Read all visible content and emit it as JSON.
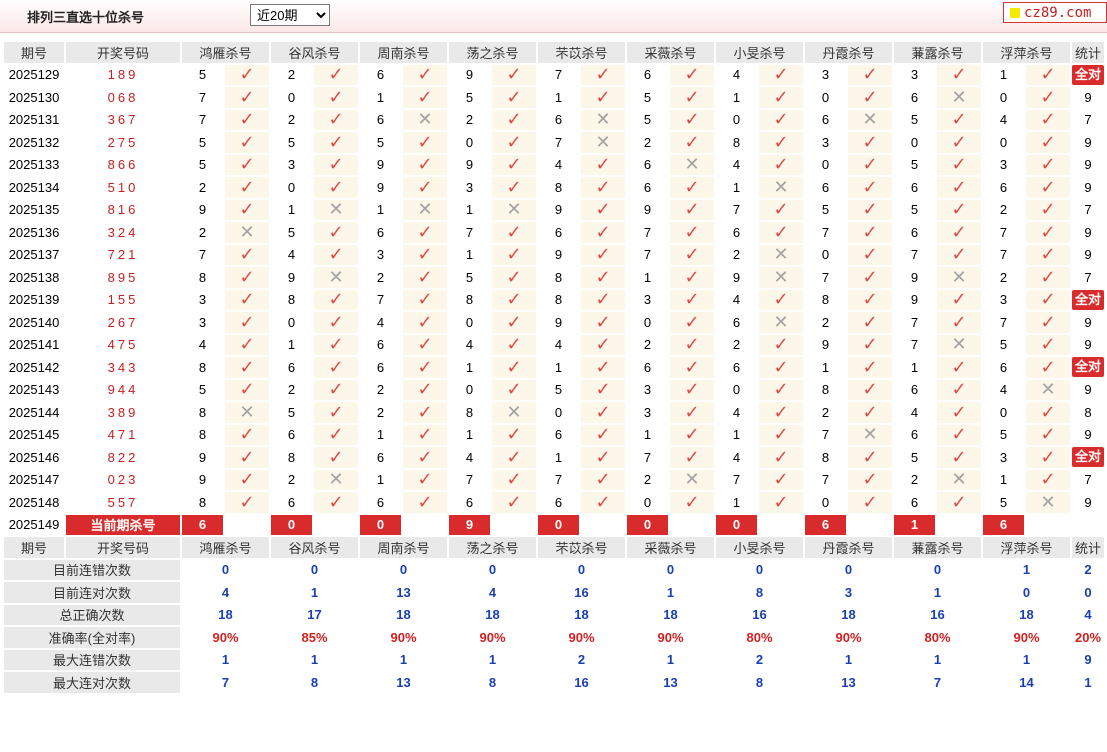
{
  "header": {
    "title": "排列三直选十位杀号",
    "select_value": "近20期",
    "select_options": [
      "近20期"
    ],
    "logo_text": "cz89.com"
  },
  "columns": {
    "period": "期号",
    "draw": "开奖号码",
    "experts": [
      "鸿雁杀号",
      "谷风杀号",
      "周南杀号",
      "荡之杀号",
      "芣苡杀号",
      "采薇杀号",
      "小旻杀号",
      "丹霞杀号",
      "蒹露杀号",
      "浮萍杀号"
    ],
    "stats": "统计"
  },
  "rows": [
    {
      "period": "2025129",
      "draw": "189",
      "kills": [
        [
          5,
          1
        ],
        [
          2,
          1
        ],
        [
          6,
          1
        ],
        [
          9,
          1
        ],
        [
          7,
          1
        ],
        [
          6,
          1
        ],
        [
          4,
          1
        ],
        [
          3,
          1
        ],
        [
          3,
          1
        ],
        [
          1,
          1
        ]
      ],
      "stat": "全对"
    },
    {
      "period": "2025130",
      "draw": "068",
      "kills": [
        [
          7,
          1
        ],
        [
          0,
          1
        ],
        [
          1,
          1
        ],
        [
          5,
          1
        ],
        [
          1,
          1
        ],
        [
          5,
          1
        ],
        [
          1,
          1
        ],
        [
          0,
          1
        ],
        [
          6,
          0
        ],
        [
          0,
          1
        ]
      ],
      "stat": "9"
    },
    {
      "period": "2025131",
      "draw": "367",
      "kills": [
        [
          7,
          1
        ],
        [
          2,
          1
        ],
        [
          6,
          0
        ],
        [
          2,
          1
        ],
        [
          6,
          0
        ],
        [
          5,
          1
        ],
        [
          0,
          1
        ],
        [
          6,
          0
        ],
        [
          5,
          1
        ],
        [
          4,
          1
        ]
      ],
      "stat": "7"
    },
    {
      "period": "2025132",
      "draw": "275",
      "kills": [
        [
          5,
          1
        ],
        [
          5,
          1
        ],
        [
          5,
          1
        ],
        [
          0,
          1
        ],
        [
          7,
          0
        ],
        [
          2,
          1
        ],
        [
          8,
          1
        ],
        [
          3,
          1
        ],
        [
          0,
          1
        ],
        [
          0,
          1
        ]
      ],
      "stat": "9"
    },
    {
      "period": "2025133",
      "draw": "866",
      "kills": [
        [
          5,
          1
        ],
        [
          3,
          1
        ],
        [
          9,
          1
        ],
        [
          9,
          1
        ],
        [
          4,
          1
        ],
        [
          6,
          0
        ],
        [
          4,
          1
        ],
        [
          0,
          1
        ],
        [
          5,
          1
        ],
        [
          3,
          1
        ]
      ],
      "stat": "9"
    },
    {
      "period": "2025134",
      "draw": "510",
      "kills": [
        [
          2,
          1
        ],
        [
          0,
          1
        ],
        [
          9,
          1
        ],
        [
          3,
          1
        ],
        [
          8,
          1
        ],
        [
          6,
          1
        ],
        [
          1,
          0
        ],
        [
          6,
          1
        ],
        [
          6,
          1
        ],
        [
          6,
          1
        ]
      ],
      "stat": "9"
    },
    {
      "period": "2025135",
      "draw": "816",
      "kills": [
        [
          9,
          1
        ],
        [
          1,
          0
        ],
        [
          1,
          0
        ],
        [
          1,
          0
        ],
        [
          9,
          1
        ],
        [
          9,
          1
        ],
        [
          7,
          1
        ],
        [
          5,
          1
        ],
        [
          5,
          1
        ],
        [
          2,
          1
        ]
      ],
      "stat": "7"
    },
    {
      "period": "2025136",
      "draw": "324",
      "kills": [
        [
          2,
          0
        ],
        [
          5,
          1
        ],
        [
          6,
          1
        ],
        [
          7,
          1
        ],
        [
          6,
          1
        ],
        [
          7,
          1
        ],
        [
          6,
          1
        ],
        [
          7,
          1
        ],
        [
          6,
          1
        ],
        [
          7,
          1
        ]
      ],
      "stat": "9"
    },
    {
      "period": "2025137",
      "draw": "721",
      "kills": [
        [
          7,
          1
        ],
        [
          4,
          1
        ],
        [
          3,
          1
        ],
        [
          1,
          1
        ],
        [
          9,
          1
        ],
        [
          7,
          1
        ],
        [
          2,
          0
        ],
        [
          0,
          1
        ],
        [
          7,
          1
        ],
        [
          7,
          1
        ]
      ],
      "stat": "9"
    },
    {
      "period": "2025138",
      "draw": "895",
      "kills": [
        [
          8,
          1
        ],
        [
          9,
          0
        ],
        [
          2,
          1
        ],
        [
          5,
          1
        ],
        [
          8,
          1
        ],
        [
          1,
          1
        ],
        [
          9,
          0
        ],
        [
          7,
          1
        ],
        [
          9,
          0
        ],
        [
          2,
          1
        ]
      ],
      "stat": "7"
    },
    {
      "period": "2025139",
      "draw": "155",
      "kills": [
        [
          3,
          1
        ],
        [
          8,
          1
        ],
        [
          7,
          1
        ],
        [
          8,
          1
        ],
        [
          8,
          1
        ],
        [
          3,
          1
        ],
        [
          4,
          1
        ],
        [
          8,
          1
        ],
        [
          9,
          1
        ],
        [
          3,
          1
        ]
      ],
      "stat": "全对"
    },
    {
      "period": "2025140",
      "draw": "267",
      "kills": [
        [
          3,
          1
        ],
        [
          0,
          1
        ],
        [
          4,
          1
        ],
        [
          0,
          1
        ],
        [
          9,
          1
        ],
        [
          0,
          1
        ],
        [
          6,
          0
        ],
        [
          2,
          1
        ],
        [
          7,
          1
        ],
        [
          7,
          1
        ]
      ],
      "stat": "9"
    },
    {
      "period": "2025141",
      "draw": "475",
      "kills": [
        [
          4,
          1
        ],
        [
          1,
          1
        ],
        [
          6,
          1
        ],
        [
          4,
          1
        ],
        [
          4,
          1
        ],
        [
          2,
          1
        ],
        [
          2,
          1
        ],
        [
          9,
          1
        ],
        [
          7,
          0
        ],
        [
          5,
          1
        ]
      ],
      "stat": "9"
    },
    {
      "period": "2025142",
      "draw": "343",
      "kills": [
        [
          8,
          1
        ],
        [
          6,
          1
        ],
        [
          6,
          1
        ],
        [
          1,
          1
        ],
        [
          1,
          1
        ],
        [
          6,
          1
        ],
        [
          6,
          1
        ],
        [
          1,
          1
        ],
        [
          1,
          1
        ],
        [
          6,
          1
        ]
      ],
      "stat": "全对"
    },
    {
      "period": "2025143",
      "draw": "944",
      "kills": [
        [
          5,
          1
        ],
        [
          2,
          1
        ],
        [
          2,
          1
        ],
        [
          0,
          1
        ],
        [
          5,
          1
        ],
        [
          3,
          1
        ],
        [
          0,
          1
        ],
        [
          8,
          1
        ],
        [
          6,
          1
        ],
        [
          4,
          0
        ]
      ],
      "stat": "9"
    },
    {
      "period": "2025144",
      "draw": "389",
      "kills": [
        [
          8,
          0
        ],
        [
          5,
          1
        ],
        [
          2,
          1
        ],
        [
          8,
          0
        ],
        [
          0,
          1
        ],
        [
          3,
          1
        ],
        [
          4,
          1
        ],
        [
          2,
          1
        ],
        [
          4,
          1
        ],
        [
          0,
          1
        ]
      ],
      "stat": "8"
    },
    {
      "period": "2025145",
      "draw": "471",
      "kills": [
        [
          8,
          1
        ],
        [
          6,
          1
        ],
        [
          1,
          1
        ],
        [
          1,
          1
        ],
        [
          6,
          1
        ],
        [
          1,
          1
        ],
        [
          1,
          1
        ],
        [
          7,
          0
        ],
        [
          6,
          1
        ],
        [
          5,
          1
        ]
      ],
      "stat": "9"
    },
    {
      "period": "2025146",
      "draw": "822",
      "kills": [
        [
          9,
          1
        ],
        [
          8,
          1
        ],
        [
          6,
          1
        ],
        [
          4,
          1
        ],
        [
          1,
          1
        ],
        [
          7,
          1
        ],
        [
          4,
          1
        ],
        [
          8,
          1
        ],
        [
          5,
          1
        ],
        [
          3,
          1
        ]
      ],
      "stat": "全对"
    },
    {
      "period": "2025147",
      "draw": "023",
      "kills": [
        [
          9,
          1
        ],
        [
          2,
          0
        ],
        [
          1,
          1
        ],
        [
          7,
          1
        ],
        [
          7,
          1
        ],
        [
          2,
          0
        ],
        [
          7,
          1
        ],
        [
          7,
          1
        ],
        [
          2,
          0
        ],
        [
          1,
          1
        ]
      ],
      "stat": "7"
    },
    {
      "period": "2025148",
      "draw": "557",
      "kills": [
        [
          8,
          1
        ],
        [
          6,
          1
        ],
        [
          6,
          1
        ],
        [
          6,
          1
        ],
        [
          6,
          1
        ],
        [
          0,
          1
        ],
        [
          1,
          1
        ],
        [
          0,
          1
        ],
        [
          6,
          1
        ],
        [
          5,
          0
        ]
      ],
      "stat": "9"
    }
  ],
  "current": {
    "period": "2025149",
    "label": "当前期杀号",
    "kills": [
      "6",
      "0",
      "0",
      "9",
      "0",
      "0",
      "0",
      "6",
      "1",
      "6"
    ]
  },
  "stats": [
    {
      "label": "目前连错次数",
      "values": [
        "0",
        "0",
        "0",
        "0",
        "0",
        "0",
        "0",
        "0",
        "0",
        "1"
      ],
      "total": "2",
      "red": false
    },
    {
      "label": "目前连对次数",
      "values": [
        "4",
        "1",
        "13",
        "4",
        "16",
        "1",
        "8",
        "3",
        "1",
        "0"
      ],
      "total": "0",
      "red": false
    },
    {
      "label": "总正确次数",
      "values": [
        "18",
        "17",
        "18",
        "18",
        "18",
        "18",
        "16",
        "18",
        "16",
        "18"
      ],
      "total": "4",
      "red": false
    },
    {
      "label": "准确率(全对率)",
      "values": [
        "90%",
        "85%",
        "90%",
        "90%",
        "90%",
        "90%",
        "80%",
        "90%",
        "80%",
        "90%"
      ],
      "total": "20%",
      "red": true
    },
    {
      "label": "最大连错次数",
      "values": [
        "1",
        "1",
        "1",
        "1",
        "2",
        "1",
        "2",
        "1",
        "1",
        "1"
      ],
      "total": "9",
      "red": false
    },
    {
      "label": "最大连对次数",
      "values": [
        "7",
        "8",
        "13",
        "8",
        "16",
        "13",
        "8",
        "13",
        "7",
        "14"
      ],
      "total": "1",
      "red": false
    }
  ],
  "icons": {
    "correct": "check-icon",
    "wrong": "cross-icon"
  },
  "colors": {
    "accent_red": "#d92b2b",
    "stat_blue": "#1a3fb3",
    "check_red": "#e34848",
    "cross_gray": "#a3a3a3"
  }
}
